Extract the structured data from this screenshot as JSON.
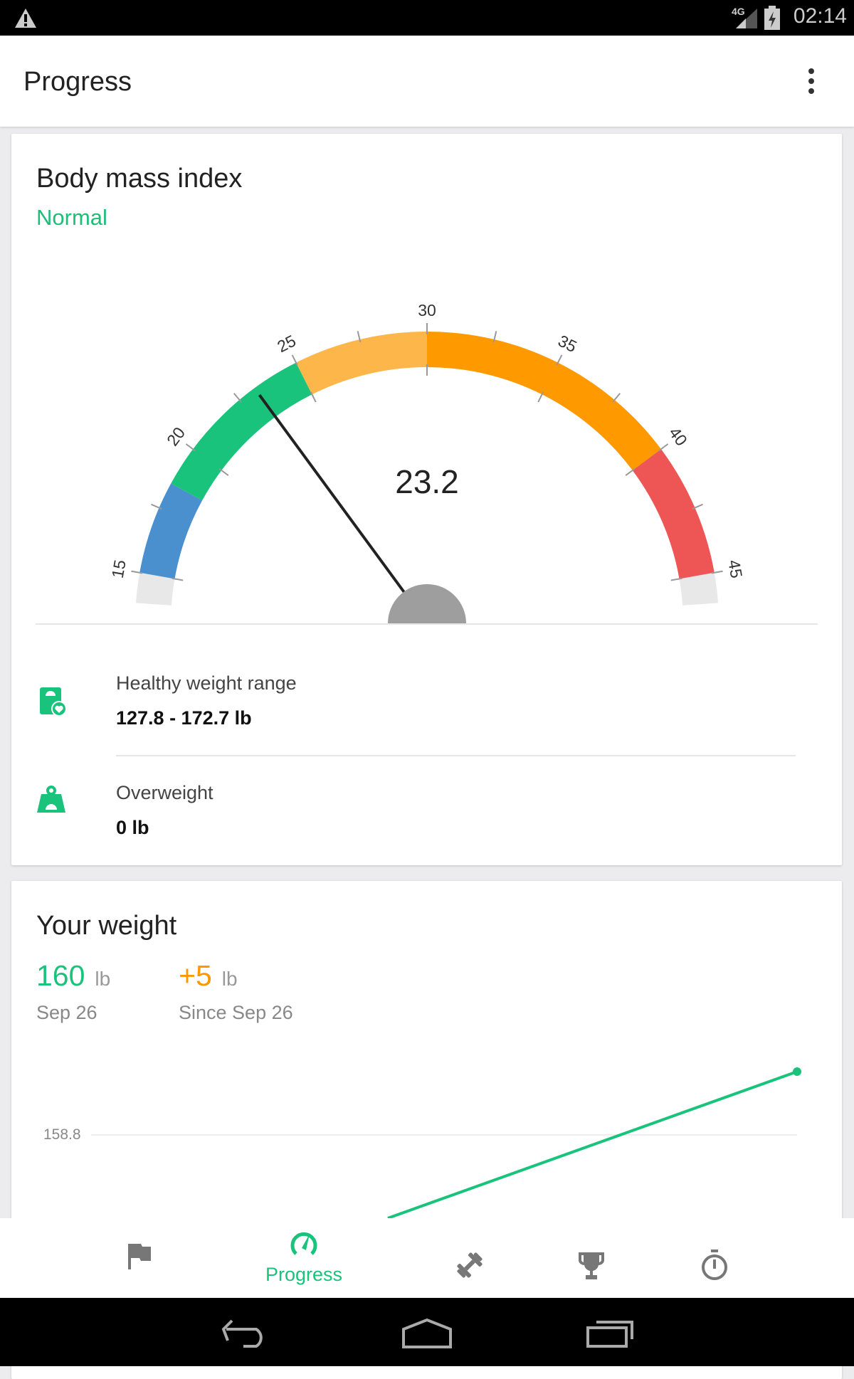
{
  "status": {
    "time": "02:14",
    "network": "4G",
    "icons": [
      "warning-icon",
      "signal-icon",
      "battery-charging-icon"
    ]
  },
  "appbar": {
    "title": "Progress",
    "menu_icon": "more-vert-icon"
  },
  "bmi": {
    "title": "Body mass index",
    "category": "Normal",
    "value": "23.2",
    "value_num": 23.2,
    "scale": {
      "min": 15,
      "max": 45,
      "labels": [
        "15",
        "20",
        "25",
        "30",
        "35",
        "40",
        "45"
      ]
    },
    "bands": [
      {
        "from": 15,
        "to": 18.5,
        "color": "#4a90cf"
      },
      {
        "from": 18.5,
        "to": 25,
        "color": "#19c37b"
      },
      {
        "from": 25,
        "to": 30,
        "color": "#fdb64a"
      },
      {
        "from": 30,
        "to": 40,
        "color": "#ff9900"
      },
      {
        "from": 40,
        "to": 45,
        "color": "#ee5555"
      }
    ],
    "rows": [
      {
        "label": "Healthy weight range",
        "value": "127.8 - 172.7 lb",
        "icon": "scale-heart-icon"
      },
      {
        "label": "Overweight",
        "value": "0 lb",
        "icon": "weight-icon"
      }
    ]
  },
  "weight": {
    "title": "Your weight",
    "current": "160",
    "current_unit": "lb",
    "current_date": "Sep 26",
    "change": "+5",
    "change_unit": "lb",
    "change_since": "Since Sep 26"
  },
  "chart_data": {
    "type": "line",
    "yticks": [
      "158.8"
    ],
    "color": "#19c37b",
    "grid": true
  },
  "bottom_nav": {
    "items": [
      {
        "icon": "flag-icon",
        "label": ""
      },
      {
        "icon": "speedometer-icon",
        "label": "Progress",
        "active": true
      },
      {
        "icon": "dumbbell-icon",
        "label": ""
      },
      {
        "icon": "trophy-icon",
        "label": ""
      },
      {
        "icon": "stopwatch-icon",
        "label": ""
      }
    ]
  },
  "colors": {
    "accent": "#19c37b",
    "change": "#ff9800"
  }
}
